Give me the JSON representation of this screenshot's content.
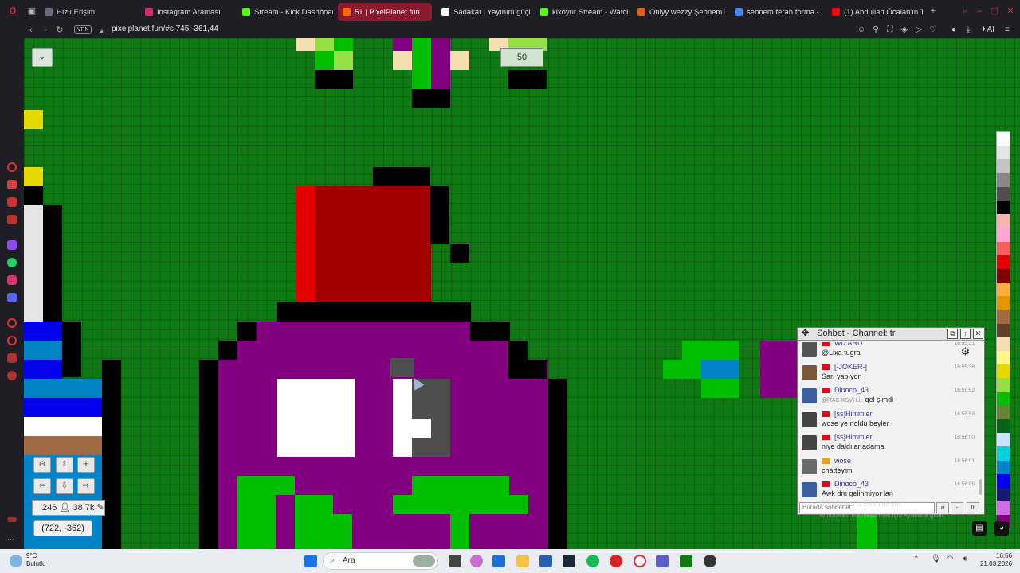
{
  "browser": {
    "tabs": [
      {
        "label": "Hızlı Erişim",
        "color": "#6a6a80"
      },
      {
        "label": "Instagram Araması",
        "color": "#d62f78"
      },
      {
        "label": "Stream - Kick Dashboard",
        "color": "#53fc18"
      },
      {
        "label": "51 | PixelPlanet.fun",
        "color": "#ff6a00",
        "active": true
      },
      {
        "label": "Sadakat | Yayınını güçle",
        "color": "#ffffff"
      },
      {
        "label": "kixoyur Stream - Watch",
        "color": "#53fc18"
      },
      {
        "label": "Onlyy wezzy Şebnem Fe",
        "color": "#e35b1e"
      },
      {
        "label": "sebnem ferah forma - G",
        "color": "#4285f4"
      },
      {
        "label": "(1) Abdullah Öcalan'ın Tü",
        "color": "#ff0000"
      }
    ],
    "vpn_label": "VPN",
    "url": "pixelplanet.fun/#s,745,-361,44"
  },
  "canvas": {
    "menu_icon": "chevron-down-icon",
    "coord_chip": "50",
    "stats": "246",
    "online_count": "38.7k",
    "cursor_coords": "(722, -362)"
  },
  "palette": [
    "#ffffff",
    "#e4e4e4",
    "#c4c4c4",
    "#888888",
    "#4e4e4e",
    "#000000",
    "#f4b3ae",
    "#ffa7d1",
    "#ff5d5d",
    "#e50000",
    "#800000",
    "#feac40",
    "#e59500",
    "#a06a42",
    "#604028",
    "#f5dfb0",
    "#fff889",
    "#e5d900",
    "#94e044",
    "#02be01",
    "#688338",
    "#006513",
    "#cae3ff",
    "#00d3dd",
    "#0083c7",
    "#0000ea",
    "#191973",
    "#cf6ee4",
    "#820080"
  ],
  "chat": {
    "title": "Sohbet - Channel: tr",
    "messages": [
      {
        "name": "WIZARD",
        "time": "16:55:31",
        "text": "@Lixa tugra",
        "mention": "",
        "flag": "#e30a17",
        "avatar": "#555"
      },
      {
        "name": "[-JOKER-]",
        "time": "16:55:36",
        "text": "Sarı yapıyon",
        "mention": "",
        "flag": "#e30a17",
        "avatar": "#7a5a3a"
      },
      {
        "name": "Dinoco_43",
        "time": "16:55:52",
        "text": "gel şimdi",
        "mention": "@[TAC-KSV] Li..",
        "flag": "#e30a17",
        "avatar": "#3b5fa0"
      },
      {
        "name": "[ss]Himmler",
        "time": "16:55:53",
        "text": "wose ye noldu beyler",
        "mention": "",
        "flag": "#e30a17",
        "avatar": "#444"
      },
      {
        "name": "[ss]Himmler",
        "time": "16:56:00",
        "text": "niye daldılar adama",
        "mention": "",
        "flag": "#e30a17",
        "avatar": "#444"
      },
      {
        "name": "wose",
        "time": "16:56:01",
        "text": "chatteyim",
        "mention": "",
        "flag": "#e8a317",
        "avatar": "#6a6a6a"
      },
      {
        "name": "Dinoco_43",
        "time": "16:56:05",
        "text": "Awk dm gelinmiyor lan",
        "mention": "",
        "flag": "#e30a17",
        "avatar": "#3b5fa0"
      }
    ],
    "input_placeholder": "Burada sohbet et",
    "channel_btn": "tr",
    "watermark": "Windows'u Etkinleştir",
    "watermark_sub": "Windows'u etkinleştirmek için Ayarlar'a gidin."
  },
  "taskbar": {
    "weather_temp": "9°C",
    "weather_desc": "Bulutlu",
    "search_label": "Ara",
    "time": "16:56",
    "date": "21.03.2026"
  }
}
